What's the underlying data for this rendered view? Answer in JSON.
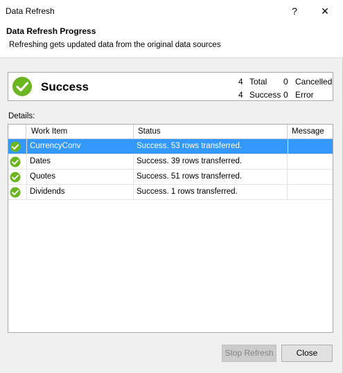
{
  "window": {
    "title": "Data Refresh",
    "help_glyph": "?",
    "close_glyph": "✕"
  },
  "header": {
    "title": "Data Refresh Progress",
    "subtitle": "Refreshing gets updated data from the original data sources"
  },
  "summary": {
    "status": "Success",
    "icon": "success-check-icon",
    "total_count": "4",
    "total_label": "Total",
    "cancelled_count": "0",
    "cancelled_label": "Cancelled",
    "success_count": "4",
    "success_label": "Success",
    "error_count": "0",
    "error_label": "Error"
  },
  "details": {
    "label": "Details:",
    "columns": [
      "Work Item",
      "Status",
      "Message"
    ],
    "rows": [
      {
        "work_item": "CurrencyConv",
        "status": "Success. 53 rows transferred.",
        "message": ""
      },
      {
        "work_item": "Dates",
        "status": "Success. 39 rows transferred.",
        "message": ""
      },
      {
        "work_item": "Quotes",
        "status": "Success. 51 rows transferred.",
        "message": ""
      },
      {
        "work_item": "Dividends",
        "status": "Success. 1 rows transferred.",
        "message": ""
      }
    ]
  },
  "footer": {
    "stop_label": "Stop Refresh",
    "close_label": "Close"
  },
  "colors": {
    "success_green": "#6ab520",
    "selection_blue": "#3399ff"
  }
}
